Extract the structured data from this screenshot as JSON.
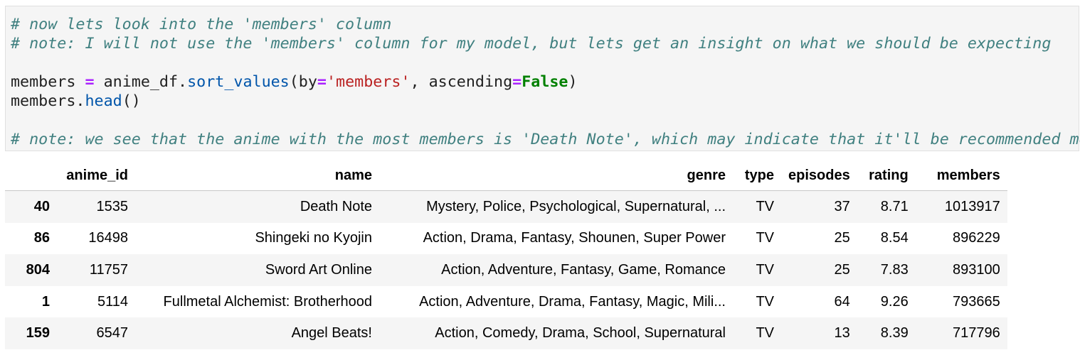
{
  "code_cell": {
    "line1_comment": "# now lets look into the 'members' column",
    "line2_comment": "# note: I will not use the 'members' column for my model, but lets get an insight on what we should be expecting",
    "line4": {
      "var": "members ",
      "assign": "=",
      "obj": " anime_df.",
      "method": "sort_values",
      "arg_open": "(by",
      "eq1": "=",
      "arg_str": "'members'",
      "arg_mid": ", ascending",
      "eq2": "=",
      "arg_bool": "False",
      "close": ")"
    },
    "line5": {
      "obj": "members.",
      "method": "head",
      "close": "()"
    },
    "line7_comment": "# note: we see that the anime with the most members is 'Death Note', which may indicate that it'll be recommended more"
  },
  "output_table": {
    "columns": [
      "",
      "anime_id",
      "name",
      "genre",
      "type",
      "episodes",
      "rating",
      "members"
    ],
    "rows": [
      {
        "index": "40",
        "anime_id": "1535",
        "name": "Death Note",
        "genre": "Mystery, Police, Psychological, Supernatural, ...",
        "type": "TV",
        "episodes": "37",
        "rating": "8.71",
        "members": "1013917"
      },
      {
        "index": "86",
        "anime_id": "16498",
        "name": "Shingeki no Kyojin",
        "genre": "Action, Drama, Fantasy, Shounen, Super Power",
        "type": "TV",
        "episodes": "25",
        "rating": "8.54",
        "members": "896229"
      },
      {
        "index": "804",
        "anime_id": "11757",
        "name": "Sword Art Online",
        "genre": "Action, Adventure, Fantasy, Game, Romance",
        "type": "TV",
        "episodes": "25",
        "rating": "7.83",
        "members": "893100"
      },
      {
        "index": "1",
        "anime_id": "5114",
        "name": "Fullmetal Alchemist: Brotherhood",
        "genre": "Action, Adventure, Drama, Fantasy, Magic, Mili...",
        "type": "TV",
        "episodes": "64",
        "rating": "9.26",
        "members": "793665"
      },
      {
        "index": "159",
        "anime_id": "6547",
        "name": "Angel Beats!",
        "genre": "Action, Comedy, Drama, School, Supernatural",
        "type": "TV",
        "episodes": "13",
        "rating": "8.39",
        "members": "717796"
      }
    ]
  }
}
